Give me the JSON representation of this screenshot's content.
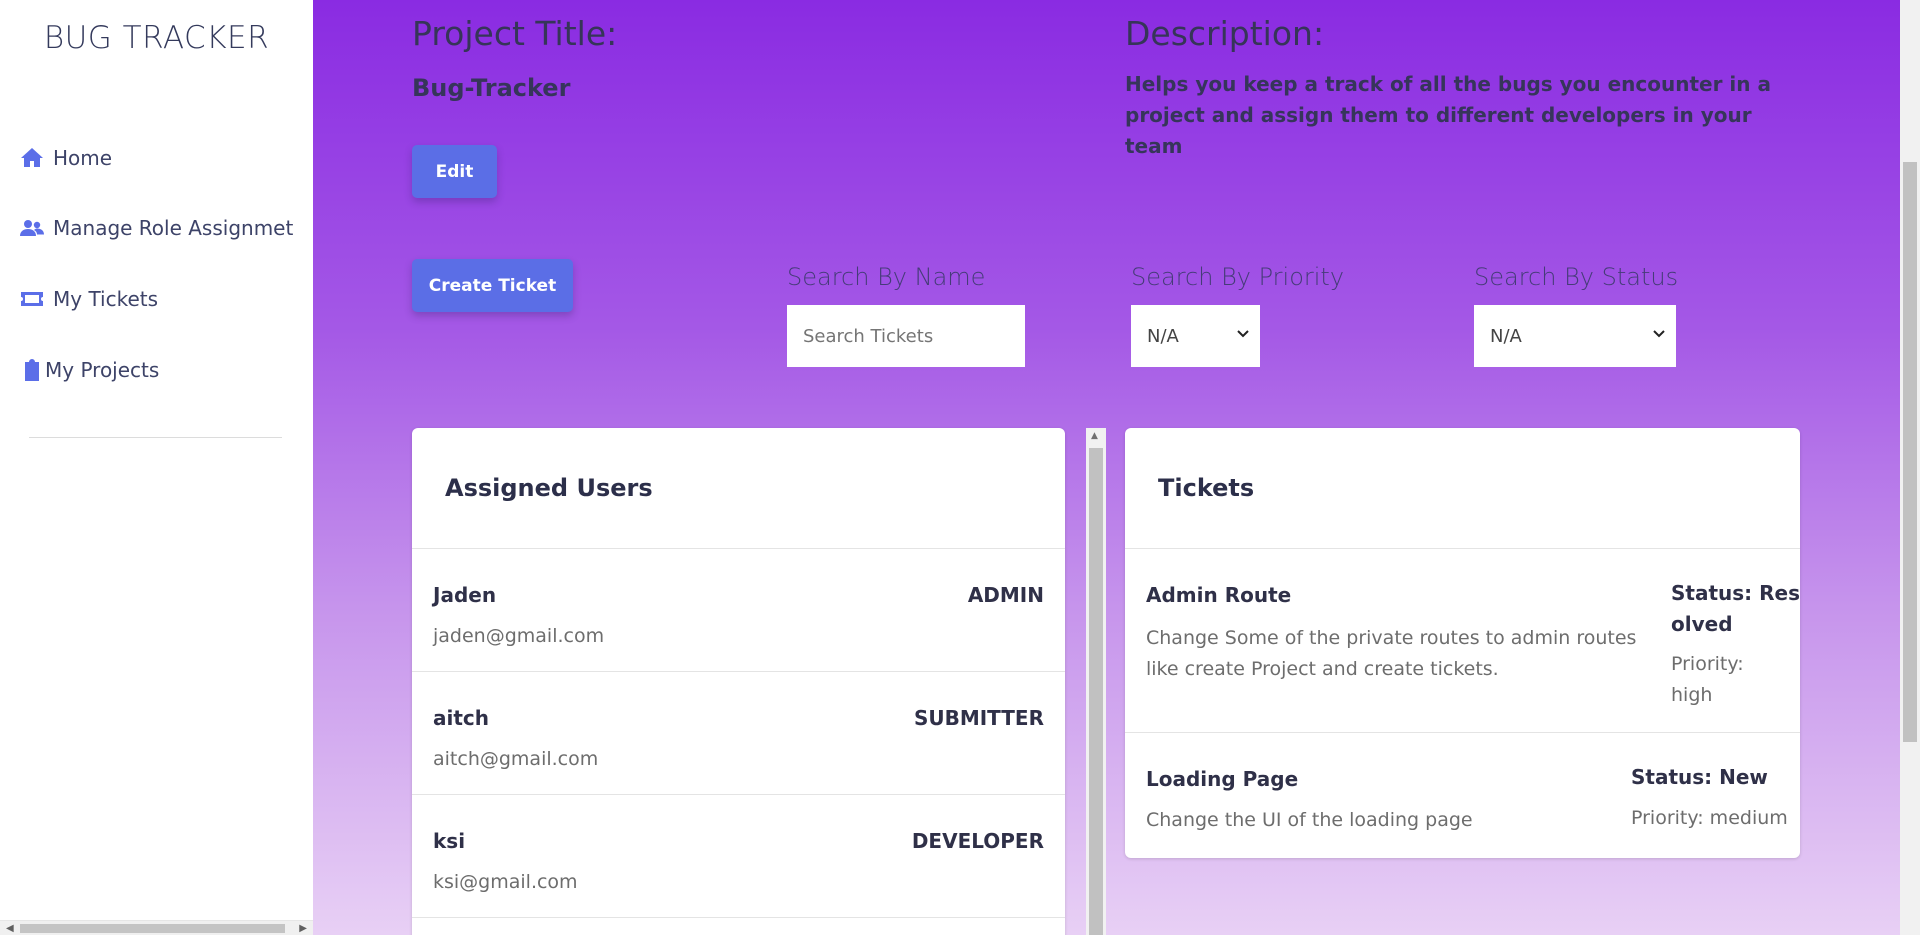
{
  "sidebar": {
    "brand": "BUG TRACKER",
    "items": [
      {
        "label": "Home",
        "icon": "home-icon"
      },
      {
        "label": "Manage Role Assignmet",
        "icon": "users-icon"
      },
      {
        "label": "My Tickets",
        "icon": "ticket-icon"
      },
      {
        "label": "My Projects",
        "icon": "clipboard-icon"
      }
    ]
  },
  "project": {
    "title_label": "Project Title:",
    "title_value": "Bug-Tracker",
    "desc_label": "Description:",
    "desc_value": "Helps you keep a track of all the bugs you encounter in a project and assign them to different developers in your team",
    "edit_button": "Edit"
  },
  "filters": {
    "create_button": "Create Ticket",
    "name_label": "Search By Name",
    "name_placeholder": "Search Tickets",
    "priority_label": "Search By Priority",
    "priority_value": "N/A",
    "status_label": "Search By Status",
    "status_value": "N/A"
  },
  "users_card": {
    "header": "Assigned Users",
    "users": [
      {
        "name": "Jaden",
        "email": "jaden@gmail.com",
        "role": "ADMIN"
      },
      {
        "name": "aitch",
        "email": "aitch@gmail.com",
        "role": "SUBMITTER"
      },
      {
        "name": "ksi",
        "email": "ksi@gmail.com",
        "role": "DEVELOPER"
      }
    ]
  },
  "tickets_card": {
    "header": "Tickets",
    "tickets": [
      {
        "title": "Admin Route",
        "description": "Change Some of the private routes to admin routes like create Project and create tickets.",
        "status_line1": "Status: Res",
        "status_line2": "olved",
        "priority_line1": "Priority:",
        "priority_line2": "high"
      },
      {
        "title": "Loading Page",
        "description": "Change the UI of the loading page",
        "status": "Status: New",
        "priority": "Priority: medium"
      }
    ]
  },
  "colors": {
    "accent": "#5b6ee6",
    "gradient_top": "#8a2be2",
    "gradient_bottom": "#e8d0f5"
  }
}
